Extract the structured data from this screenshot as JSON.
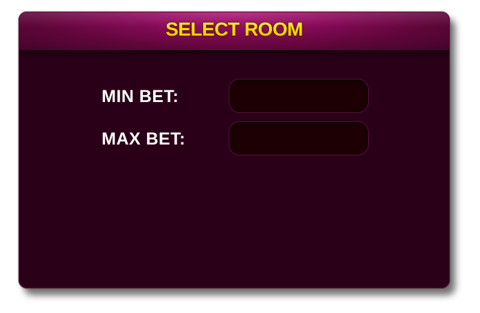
{
  "dialog": {
    "title": "SELECT ROOM",
    "min_bet": {
      "label": "MIN BET:",
      "value": ""
    },
    "max_bet": {
      "label": "MAX BET:",
      "value": ""
    }
  },
  "colors": {
    "title_text": "#ffe400",
    "header": "#8a0a5a",
    "panel_background": "#2a0018",
    "field_background": "#1c0004",
    "label_text": "#ffffff"
  }
}
